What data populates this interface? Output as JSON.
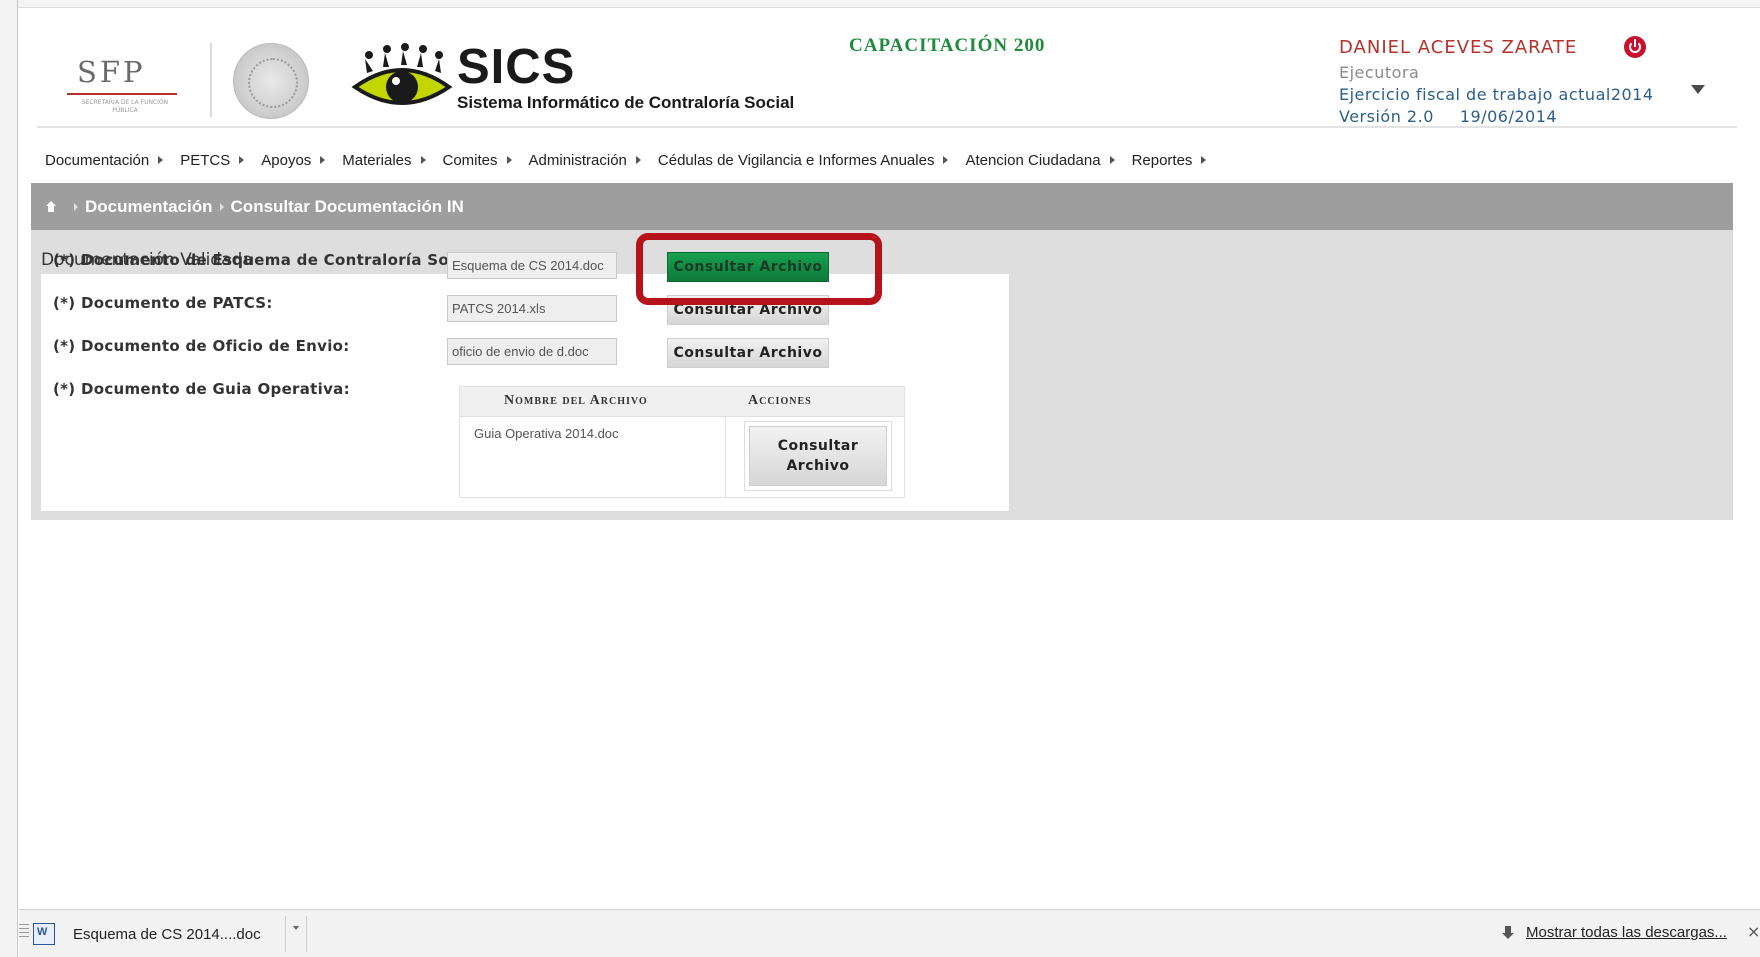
{
  "header": {
    "sfp_logo_text": "SFP",
    "sfp_logo_subtext": "SECRETARÍA DE LA FUNCIÓN PÚBLICA",
    "app_title": "SICS",
    "app_subtitle": "Sistema Informático de Contraloría Social",
    "environment_label": "CAPACITACIÓN 200",
    "user": {
      "name": "DANIEL ACEVES ZARATE",
      "role": "Ejecutora",
      "fiscal_year": "Ejercicio fiscal de trabajo actual2014",
      "version": "Versión 2.0",
      "date": "19/06/2014"
    }
  },
  "menu": {
    "items": [
      {
        "label": "Documentación"
      },
      {
        "label": "PETCS"
      },
      {
        "label": "Apoyos"
      },
      {
        "label": "Materiales"
      },
      {
        "label": "Comites"
      },
      {
        "label": "Administración"
      },
      {
        "label": "Cédulas de Vigilancia e Informes Anuales"
      },
      {
        "label": "Atencion Ciudadana"
      },
      {
        "label": "Reportes"
      }
    ]
  },
  "breadcrumb": {
    "items": [
      "Documentación",
      "Consultar Documentación IN"
    ]
  },
  "main": {
    "section_title": "Documentación Validada",
    "fields": [
      {
        "label": "(*) Documento de Esquema de Contraloría Social:",
        "value": "Esquema de CS 2014.doc",
        "button": "Consultar Archivo"
      },
      {
        "label": "(*) Documento de PATCS:",
        "value": "PATCS 2014.xls",
        "button": "Consultar Archivo"
      },
      {
        "label": "(*) Documento de Oficio de Envio:",
        "value": "oficio de envio de d.doc",
        "button": "Consultar Archivo"
      },
      {
        "label": "(*) Documento de Guia Operativa:"
      }
    ],
    "guide_table": {
      "columns": [
        "Nombre del Archivo",
        "Acciones"
      ],
      "rows": [
        {
          "file": "Guia Operativa 2014.doc",
          "button_line1": "Consultar",
          "button_line2": "Archivo"
        }
      ]
    }
  },
  "download_bar": {
    "item_name": "Esquema de CS 2014....doc",
    "show_all": "Mostrar todas las descargas...",
    "close": "×"
  },
  "colors": {
    "brand_red": "#b7312c",
    "env_green": "#1e8a3c",
    "active_button": "#0d7a3a",
    "highlight": "#b5121b",
    "breadcrumb_bg": "#9e9e9e"
  }
}
